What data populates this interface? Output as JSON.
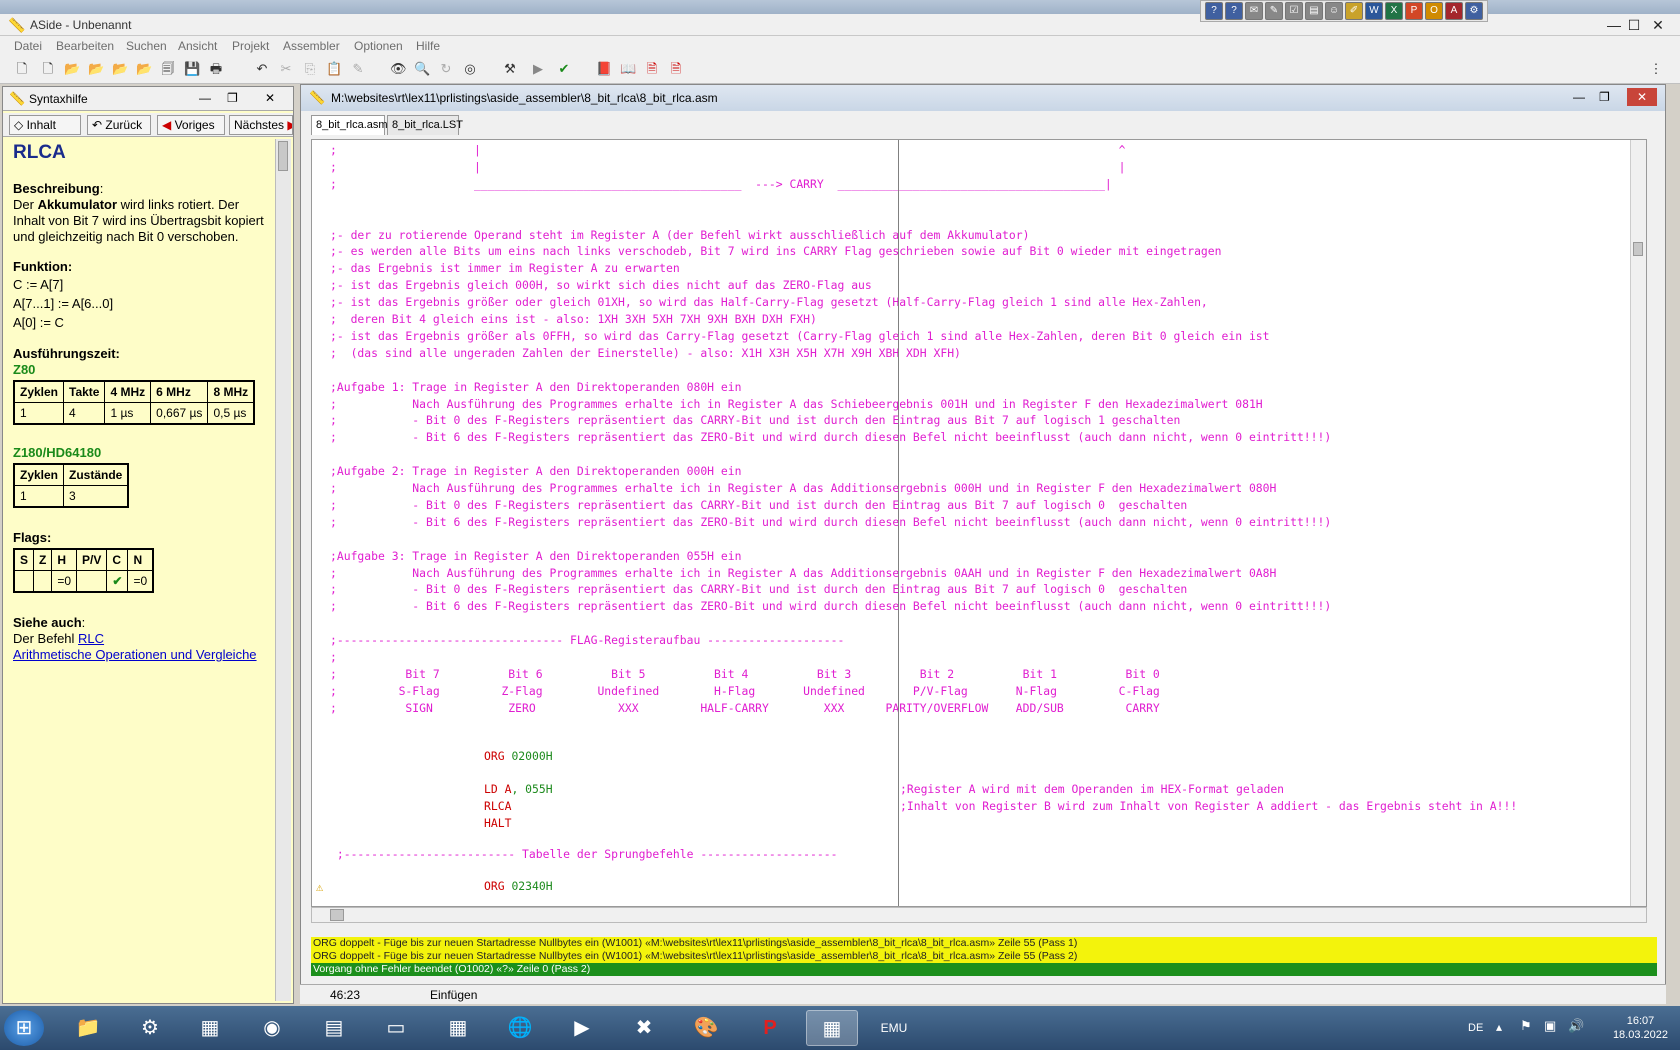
{
  "window": {
    "title": "ASide - Unbenannt"
  },
  "menu": [
    "Datei",
    "Bearbeiten",
    "Suchen",
    "Ansicht",
    "Projekt",
    "Assembler",
    "Optionen",
    "Hilfe"
  ],
  "help": {
    "title": "Syntaxhilfe",
    "nav": {
      "inhalt": "Inhalt",
      "zurueck": "Zurück",
      "voriges": "Voriges",
      "naechstes": "Nächstes"
    },
    "heading": "RLCA",
    "desc_label": "Beschreibung",
    "desc_pre": "Der ",
    "desc_bold": "Akkumulator",
    "desc_post": " wird links rotiert. Der Inhalt von Bit 7 wird ins Übertragsbit kopiert und gleichzeitig nach Bit 0 verschoben.",
    "func_label": "Funktion:",
    "func_lines": [
      "C := A[7]",
      "A[7...1] := A[6...0]",
      "A[0] := C"
    ],
    "exec_label": "Ausführungszeit:",
    "z80_label": "Z80",
    "z80_headers": [
      "Zyklen",
      "Takte",
      "4 MHz",
      "6 MHz",
      "8 MHz"
    ],
    "z80_row": [
      "1",
      "4",
      "1 µs",
      "0,667 µs",
      "0,5 µs"
    ],
    "z180_label": "Z180/HD64180",
    "z180_headers": [
      "Zyklen",
      "Zustände"
    ],
    "z180_row": [
      "1",
      "3"
    ],
    "flags_label": "Flags:",
    "flags_headers": [
      "S",
      "Z",
      "H",
      "P/V",
      "C",
      "N"
    ],
    "flags_row": [
      "",
      "",
      "=0",
      "",
      "✔",
      "=0"
    ],
    "see_label": "Siehe auch",
    "see_pre": "Der Befehl ",
    "see_link1": "RLC",
    "see_link2": "Arithmetische Operationen und Vergleiche"
  },
  "editor": {
    "path": "M:\\websites\\rt\\lex11\\prlistings\\aside_assembler\\8_bit_rlca\\8_bit_rlca.asm",
    "tabs": [
      "8_bit_rlca.asm",
      "8_bit_rlca.LST"
    ],
    "lines": [
      ";                    |                                                                                             ^",
      ";                    |                                                                                             |",
      ";                    _______________________________________  ---> CARRY  _______________________________________|",
      "",
      "",
      ";- der zu rotierende Operand steht im Register A (der Befehl wirkt ausschließlich auf dem Akkumulator)",
      ";- es werden alle Bits um eins nach links verschodeb, Bit 7 wird ins CARRY Flag geschrieben sowie auf Bit 0 wieder mit eingetragen",
      ";- das Ergebnis ist immer im Register A zu erwarten",
      ";- ist das Ergebnis gleich 000H, so wirkt sich dies nicht auf das ZERO-Flag aus",
      ";- ist das Ergebnis größer oder gleich 01XH, so wird das Half-Carry-Flag gesetzt (Half-Carry-Flag gleich 1 sind alle Hex-Zahlen,",
      ";  deren Bit 4 gleich eins ist - also: 1XH 3XH 5XH 7XH 9XH BXH DXH FXH)",
      ";- ist das Ergebnis größer als 0FFH, so wird das Carry-Flag gesetzt (Carry-Flag gleich 1 sind alle Hex-Zahlen, deren Bit 0 gleich ein ist",
      ";  (das sind alle ungeraden Zahlen der Einerstelle) - also: X1H X3H X5H X7H X9H XBH XDH XFH)",
      "",
      ";Aufgabe 1: Trage in Register A den Direktoperanden 080H ein",
      ";           Nach Ausführung des Programmes erhalte ich in Register A das Schiebeergebnis 001H und in Register F den Hexadezimalwert 081H",
      ";           - Bit 0 des F-Registers repräsentiert das CARRY-Bit und ist durch den Eintrag aus Bit 7 auf logisch 1 geschalten",
      ";           - Bit 6 des F-Registers repräsentiert das ZERO-Bit und wird durch diesen Befel nicht beeinflusst (auch dann nicht, wenn 0 eintritt!!!)",
      "",
      ";Aufgabe 2: Trage in Register A den Direktoperanden 000H ein",
      ";           Nach Ausführung des Programmes erhalte ich in Register A das Additionsergebnis 000H und in Register F den Hexadezimalwert 080H",
      ";           - Bit 0 des F-Registers repräsentiert das CARRY-Bit und ist durch den Eintrag aus Bit 7 auf logisch 0  geschalten",
      ";           - Bit 6 des F-Registers repräsentiert das ZERO-Bit und wird durch diesen Befel nicht beeinflusst (auch dann nicht, wenn 0 eintritt!!!)",
      "",
      ";Aufgabe 3: Trage in Register A den Direktoperanden 055H ein",
      ";           Nach Ausführung des Programmes erhalte ich in Register A das Additionsergebnis 0AAH und in Register F den Hexadezimalwert 0A8H",
      ";           - Bit 0 des F-Registers repräsentiert das CARRY-Bit und ist durch den Eintrag aus Bit 7 auf logisch 0  geschalten",
      ";           - Bit 6 des F-Registers repräsentiert das ZERO-Bit und wird durch diesen Befel nicht beeinflusst (auch dann nicht, wenn 0 eintritt!!!)",
      "",
      ";--------------------------------- FLAG-Registeraufbau --------------------",
      ";",
      ";          Bit 7          Bit 6          Bit 5          Bit 4          Bit 3          Bit 2          Bit 1          Bit 0",
      ";         S-Flag         Z-Flag        Undefined        H-Flag       Undefined       P/V-Flag       N-Flag         C-Flag",
      ";          SIGN           ZERO            XXX         HALF-CARRY        XXX      PARITY/OVERFLOW    ADD/SUB         CARRY"
    ],
    "code": {
      "org1_kw": "ORG",
      "org1_val": "02000H",
      "ld_kw": "LD",
      "ld_reg": "A",
      "ld_val": ", 055H",
      "ld_comment": ";Register A wird mit dem Operanden im HEX-Format geladen",
      "rlca": "RLCA",
      "rlca_comment": ";Inhalt von Register B wird zum Inhalt von Register A addiert - das Ergebnis steht in A!!!",
      "halt": "HALT",
      "table_comment": " ;------------------------- Tabelle der Sprungbefehle --------------------",
      "org2_kw": "ORG",
      "org2_val": "02340H"
    },
    "messages": [
      "ORG doppelt - Füge bis zur neuen Startadresse Nullbytes ein (W1001) «M:\\websites\\rt\\lex11\\prlistings\\aside_assembler\\8_bit_rlca\\8_bit_rlca.asm» Zeile 55 (Pass 1)",
      "ORG doppelt - Füge bis zur neuen Startadresse Nullbytes ein (W1001) «M:\\websites\\rt\\lex11\\prlistings\\aside_assembler\\8_bit_rlca\\8_bit_rlca.asm» Zeile 55 (Pass 2)",
      "Vorgang ohne Fehler beendet (O1002) «?» Zeile 0 (Pass 2)"
    ]
  },
  "status": {
    "position": "46:23",
    "mode": "Einfügen"
  },
  "taskbar": {
    "lang": "DE",
    "time": "16:07",
    "date": "18.03.2022"
  }
}
